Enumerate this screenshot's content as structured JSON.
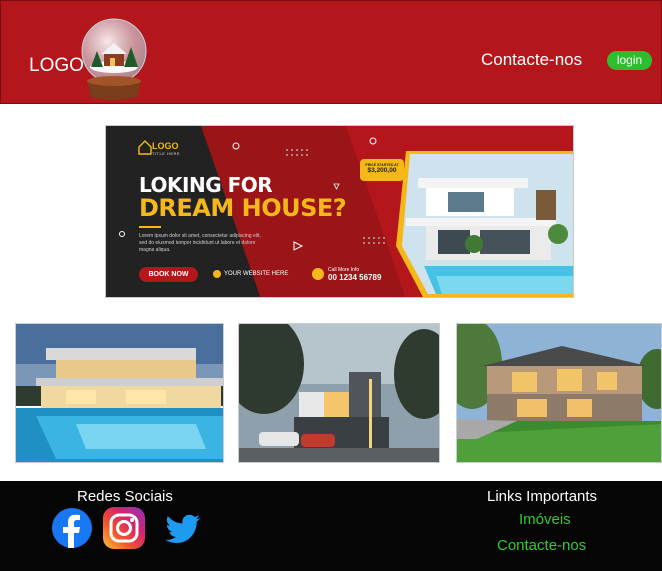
{
  "header": {
    "logo_text": "LOGO",
    "contact_label": "Contacte-nos",
    "login_label": "login"
  },
  "banner": {
    "logo": "LOGO",
    "logo_sub": "TITLE HERE",
    "title_line1": "LOKING FOR",
    "title_line2": "DREAM HOUSE?",
    "description": "Lorem ipsum dolor sit amet, consectetur adipiscing elit, sed do eiusmod tempor incididunt ut labore et dolore magna aliqua.",
    "book_button": "BOOK NOW",
    "website": "YOUR WEBSITE HERE",
    "call_label": "Call More Info",
    "call_number": "00 1234 56789",
    "price_label": "PRICE STARTED AT",
    "price_value": "$3,200,00"
  },
  "footer": {
    "social_title": "Redes Sociais",
    "links_title": "Links Importants",
    "links": [
      "Imóveis",
      "Contacte-nos"
    ]
  },
  "colors": {
    "brand_red": "#b5161b",
    "accent_green": "#2ebd2e",
    "banner_yellow": "#f5b81a"
  },
  "icons": {
    "social": [
      "facebook-icon",
      "instagram-icon",
      "twitter-icon"
    ]
  }
}
